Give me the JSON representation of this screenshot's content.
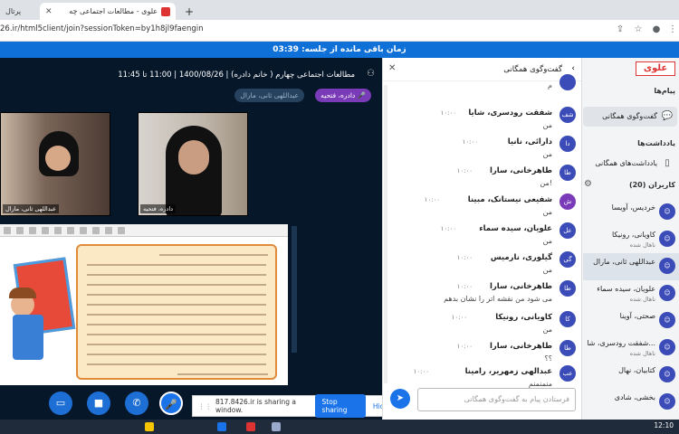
{
  "browser": {
    "tabs": [
      {
        "label": "پرتال",
        "color": "#1a73e8"
      },
      {
        "label": "علوی - مطالعات اجتماعی چه",
        "color": "#d33"
      }
    ],
    "url": "26.ir/html5client/join?sessionToken=by1h8jl9faengin"
  },
  "timer": {
    "text": "زمان باقی مانده از جلسه: 03:39"
  },
  "session": {
    "title": "مطالعات اجتماعی چهارم ( خانم دادره) | 1400/08/26 | 11:00 تا 11:45"
  },
  "speakers": {
    "speaker1": "دادره، فتحیه",
    "speaker2": "عبداللهی ثانی، مارال"
  },
  "videos": [
    {
      "name": "عبداللهی ثانی، مارال"
    },
    {
      "name": "دادره، فتحیه"
    }
  ],
  "share": {
    "text": "817.8426.ir is sharing a window.",
    "stop": "Stop sharing",
    "hide": "Hide"
  },
  "chat": {
    "title": "گفت‌وگوی همگانی",
    "input_placeholder": "فرستادن پیام به گفت‌وگوی همگانی",
    "messages": [
      {
        "sender": "",
        "time": "",
        "body": "م",
        "avatar": "",
        "color": "#3b4bb8"
      },
      {
        "sender": "شفقت رودسری، شایا",
        "time": "۱۰:۰۰",
        "body": "من",
        "avatar": "شف",
        "color": "#3b4bb8"
      },
      {
        "sender": "دارائی، نانیا",
        "time": "۱۰:۰۰",
        "body": "من",
        "avatar": "دا",
        "color": "#3b4bb8"
      },
      {
        "sender": "طاهرخانی، سارا",
        "time": "۱۰:۰۰",
        "body": "من!",
        "avatar": "طا",
        "color": "#3b4bb8"
      },
      {
        "sender": "شفیعی نیستانک، مبینا",
        "time": "۱۰:۰۰",
        "body": "من",
        "avatar": "ش",
        "color": "#7a3bb8"
      },
      {
        "sender": "علویان، سیده سماء",
        "time": "۱۰:۰۰",
        "body": "من",
        "avatar": "عل",
        "color": "#3b4bb8"
      },
      {
        "sender": "گیلوری، نارمیس",
        "time": "۱۰:۰۰",
        "body": "من",
        "avatar": "گی",
        "color": "#3b4bb8"
      },
      {
        "sender": "طاهرخانی، سارا",
        "time": "۱۰:۰۰",
        "body": "می شود من نقشه اتر را نشان بدهم",
        "avatar": "طا",
        "color": "#3b4bb8"
      },
      {
        "sender": "کاویانی، رونیکا",
        "time": "۱۰:۰۰",
        "body": "من",
        "avatar": "کا",
        "color": "#3b4bb8"
      },
      {
        "sender": "طاهرخانی، سارا",
        "time": "۱۰:۰۰",
        "body": "؟؟",
        "avatar": "طا",
        "color": "#3b4bb8"
      },
      {
        "sender": "عبدالهی زمهریر، رامینا",
        "time": "۱۰:۰۰",
        "body": "منمنمنم",
        "avatar": "عب",
        "color": "#3b4bb8"
      }
    ]
  },
  "sidebar": {
    "logo": "علوی",
    "messages_section": "پیام‌ها",
    "public_chat": "گفت‌وگوی همگانی",
    "notes_section": "یادداشت‌ها",
    "shared_notes": "یادداشت‌های همگانی",
    "users_section": "کاربران (20)",
    "users": [
      {
        "name": "خردیس، آویسا",
        "status": ""
      },
      {
        "name": "کاویانی، رونیکا",
        "status": "ناهال شده"
      },
      {
        "name": "عبداللهی ثانی، مارال",
        "status": ""
      },
      {
        "name": "علویان، سیده سماء",
        "status": "ناهال شده"
      },
      {
        "name": "صحتی، آوینا",
        "status": ""
      },
      {
        "name": "شفقت رودسری، شا...",
        "status": "ناهال شده"
      },
      {
        "name": "کتابیان، نهال",
        "status": ""
      },
      {
        "name": "بخشی، شادی",
        "status": ""
      }
    ]
  },
  "taskbar": {
    "time": "12:10"
  }
}
